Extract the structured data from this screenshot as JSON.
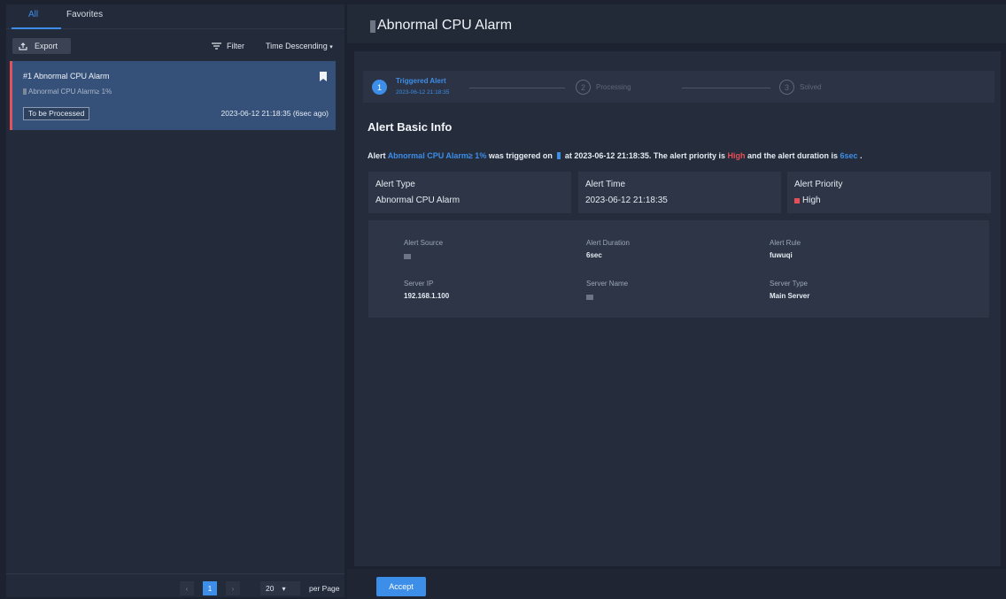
{
  "tabs": {
    "all": "All",
    "favorites": "Favorites"
  },
  "toolbar": {
    "export": "Export",
    "filter": "Filter",
    "sort": "Time Descending"
  },
  "alert_list": [
    {
      "title": "#1 Abnormal CPU Alarm",
      "subtitle": "Abnormal CPU Alarm≥ 1%",
      "status": "To be Processed",
      "time": "2023-06-12 21:18:35 (6sec ago)"
    }
  ],
  "pagination": {
    "current": "1",
    "page_size": "20",
    "per_page_label": "per Page"
  },
  "detail": {
    "title": "Abnormal CPU Alarm",
    "steps": [
      {
        "num": "1",
        "label": "Triggered Alert",
        "time": "2023-06-12 21:18:35"
      },
      {
        "num": "2",
        "label": "Processing"
      },
      {
        "num": "3",
        "label": "Solved"
      }
    ],
    "section_title": "Alert Basic Info",
    "summary": {
      "p1": "Alert",
      "alert_name": "Abnormal CPU Alarm≥ 1%",
      "p2": "was triggered on",
      "p3": "at 2023-06-12 21:18:35. The alert priority is",
      "priority": "High",
      "p4": "and the alert duration is",
      "duration": "6sec",
      "p5": "."
    },
    "basic": {
      "alert_type_label": "Alert Type",
      "alert_type": "Abnormal CPU Alarm",
      "alert_time_label": "Alert Time",
      "alert_time": "2023-06-12 21:18:35",
      "alert_priority_label": "Alert Priority",
      "alert_priority": "High"
    },
    "details": {
      "source_label": "Alert Source",
      "duration_label": "Alert Duration",
      "duration": "6sec",
      "rule_label": "Alert Rule",
      "rule": "fuwuqi",
      "server_ip_label": "Server IP",
      "server_ip": "192.168.1.100",
      "server_name_label": "Server Name",
      "server_type_label": "Server Type",
      "server_type": "Main Server"
    },
    "accept": "Accept"
  },
  "colors": {
    "accent": "#3d8ee8",
    "danger": "#e84e57",
    "card_bg": "#35517a"
  }
}
